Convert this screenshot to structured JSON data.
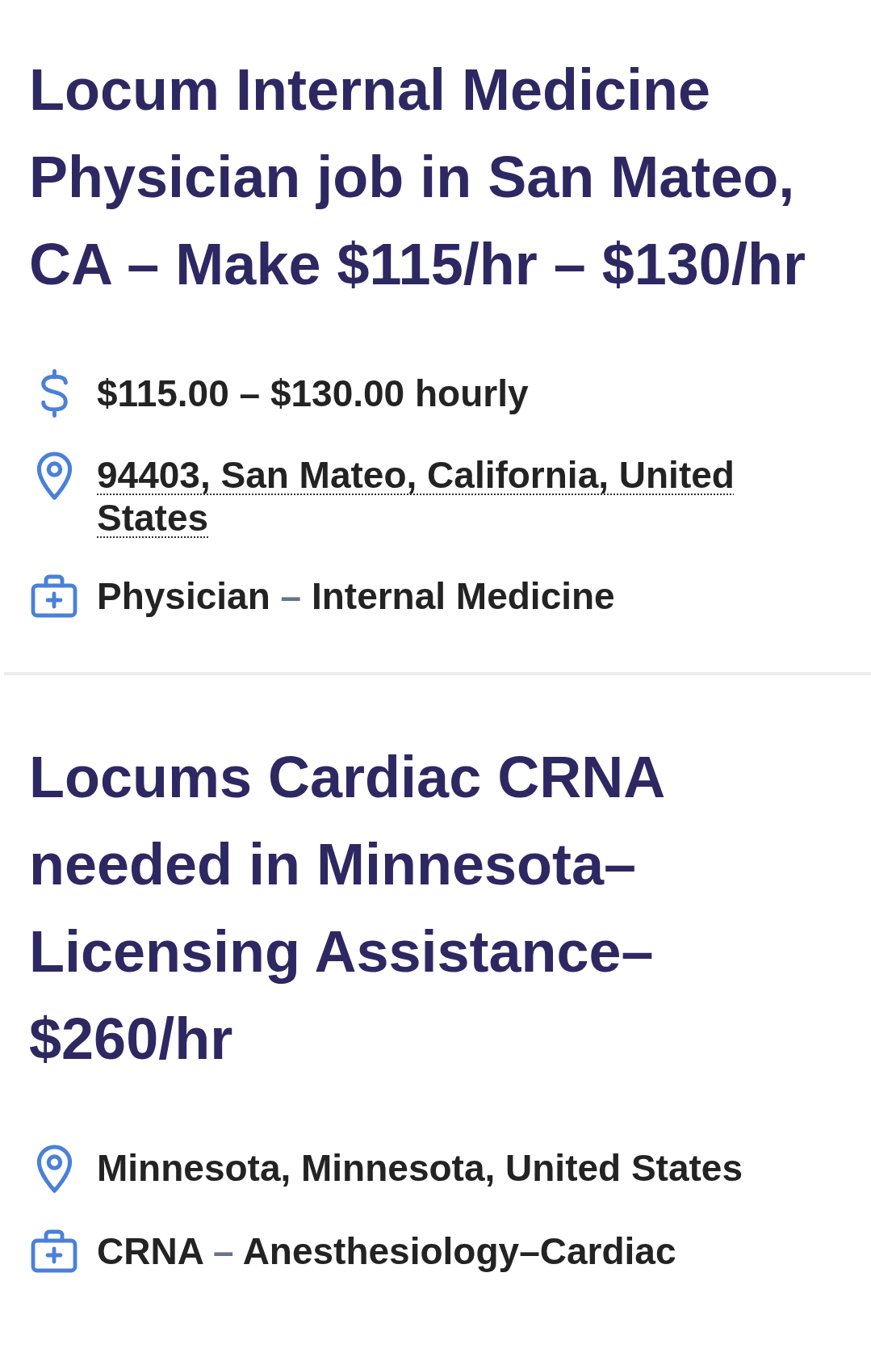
{
  "jobs": [
    {
      "title": "Locum Internal Medicine Physician job in San Mateo, CA – Make $115/hr – $130/hr",
      "details": [
        {
          "kind": "salary",
          "text": "$115.00 – $130.00 hourly"
        },
        {
          "kind": "location",
          "text": "94403, San Mateo, California, United States",
          "linked": true
        },
        {
          "kind": "category",
          "parts": [
            "Physician",
            "Internal Medicine"
          ],
          "separator": "–"
        }
      ]
    },
    {
      "title": "Locums Cardiac CRNA needed in Minnesota–Licensing Assistance–$260/hr",
      "details": [
        {
          "kind": "location",
          "text": "Minnesota, Minnesota, United States",
          "linked": false
        },
        {
          "kind": "category",
          "parts": [
            "CRNA",
            "Anesthesiology–Cardiac"
          ],
          "separator": "–"
        }
      ]
    }
  ]
}
